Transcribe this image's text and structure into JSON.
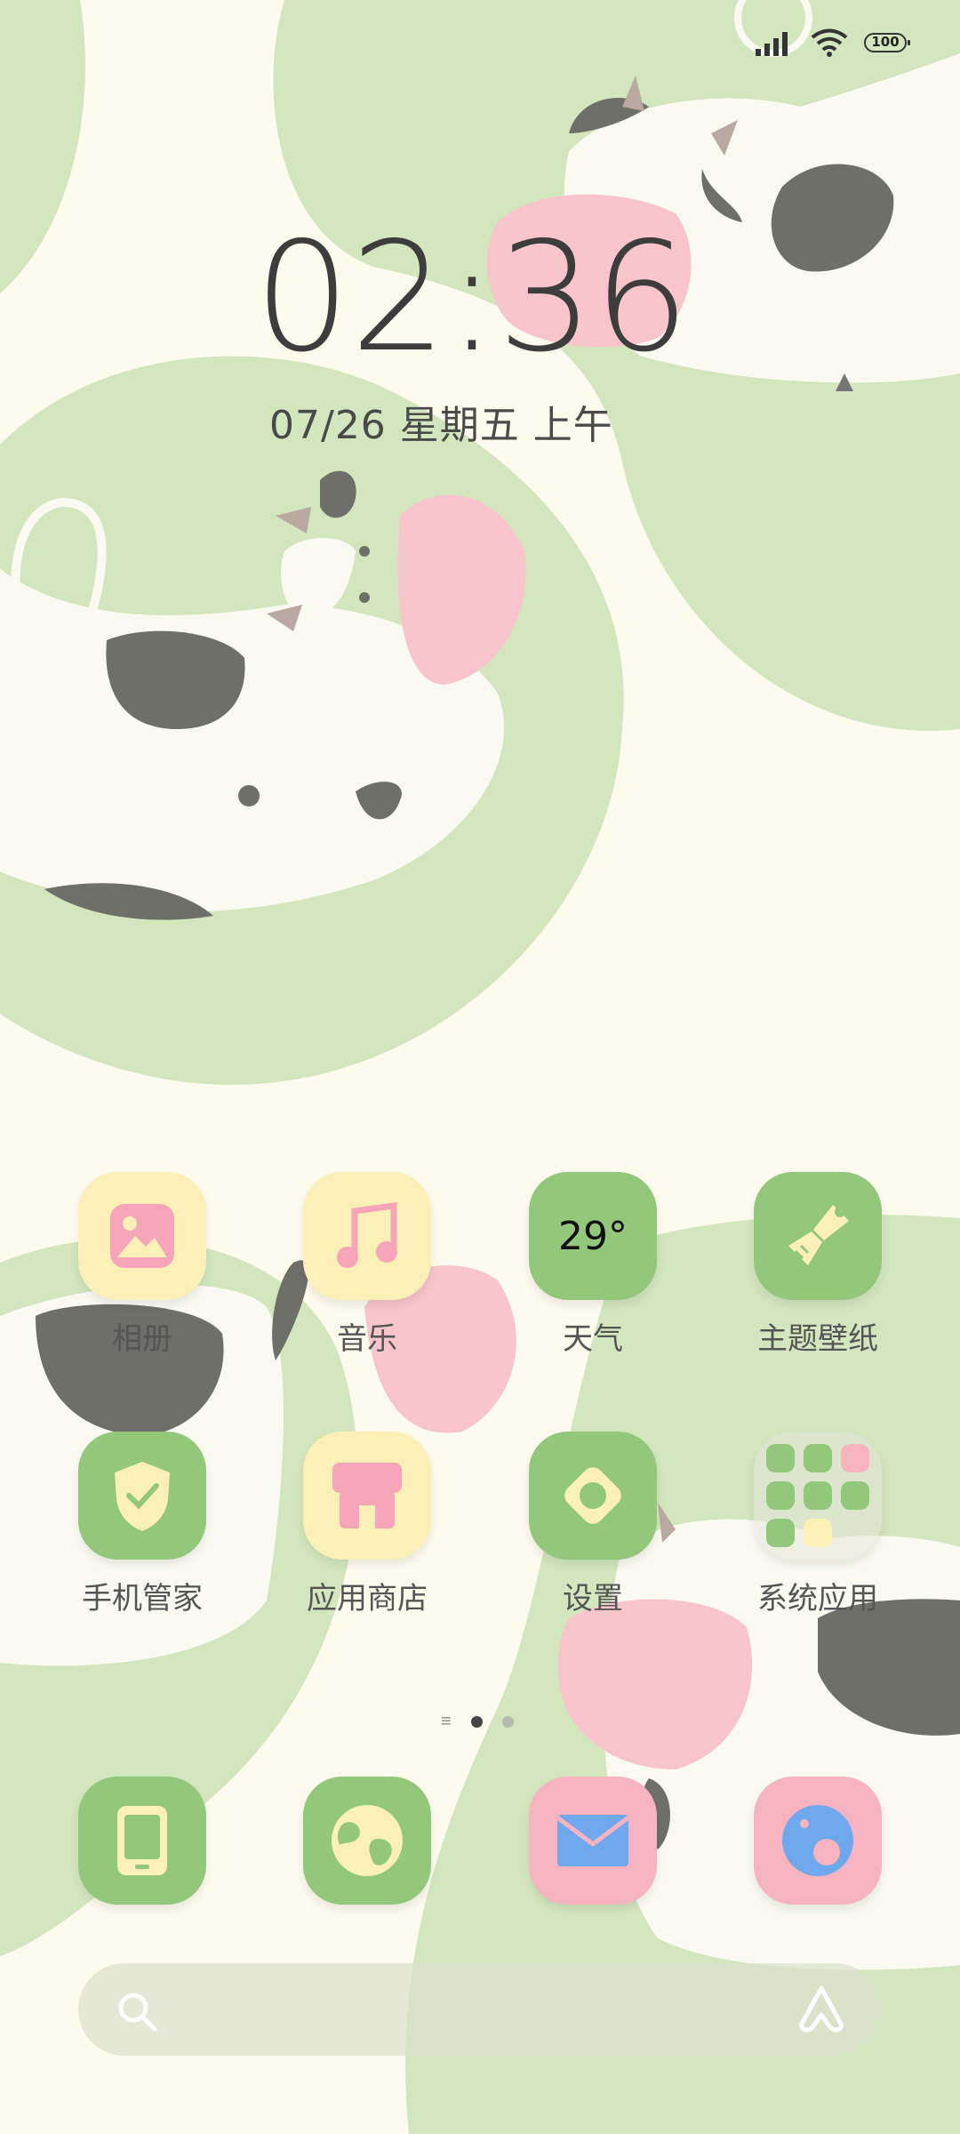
{
  "status_bar": {
    "battery": "100"
  },
  "lock": {
    "time": "02:36",
    "date": "07/26 星期五 上午"
  },
  "apps": {
    "row1": [
      "相册",
      "音乐",
      "天气",
      "主题壁纸"
    ],
    "row2": [
      "手机管家",
      "应用商店",
      "设置",
      "系统应用"
    ]
  },
  "weather": {
    "temp": "29°"
  },
  "dock": {
    "icons": [
      "phone-icon",
      "browser-icon",
      "mail-icon",
      "camera-icon"
    ]
  },
  "page_indicator": {
    "pages": 2,
    "current": 1
  },
  "colors": {
    "background": "#fdfbee",
    "blob_green": "#d3e6be",
    "tile_green": "#93c77c",
    "tile_yellow": "#fbf0b8",
    "tile_pink": "#f6b4c0",
    "text": "#555555"
  }
}
